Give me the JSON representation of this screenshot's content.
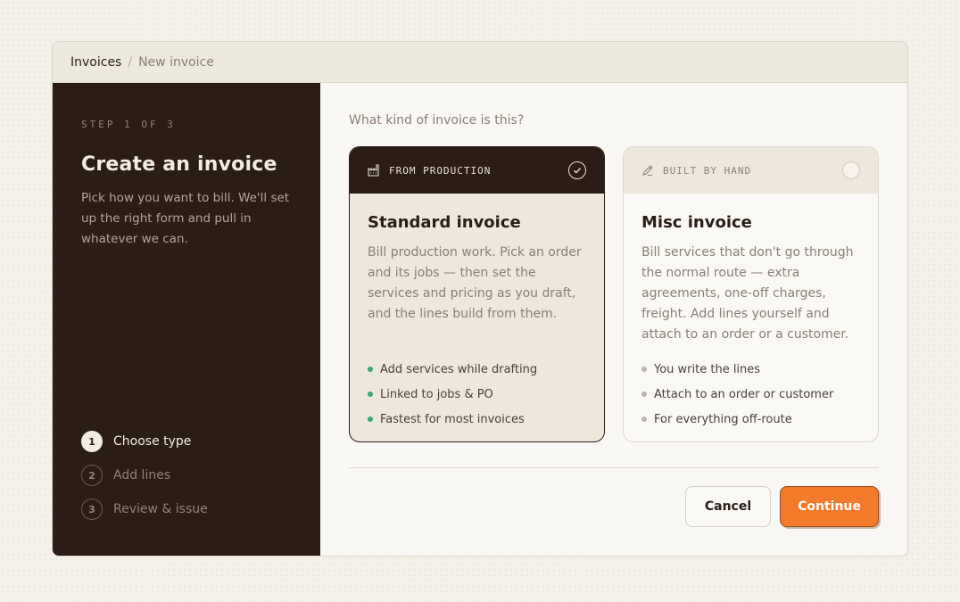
{
  "breadcrumb": {
    "parent": "Invoices",
    "separator": "/",
    "current": "New invoice"
  },
  "sidebar": {
    "step_label": "STEP 1 OF 3",
    "title": "Create an invoice",
    "description": "Pick how you want to bill. We'll set up the right form and pull in whatever we can.",
    "steps": [
      {
        "num": "1",
        "label": "Choose type",
        "state": "active"
      },
      {
        "num": "2",
        "label": "Add lines",
        "state": "inactive"
      },
      {
        "num": "3",
        "label": "Review & issue",
        "state": "inactive"
      }
    ]
  },
  "main": {
    "question": "What kind of invoice is this?",
    "cards": [
      {
        "tag": "FROM PRODUCTION",
        "icon": "factory-icon",
        "selected": true,
        "title": "Standard invoice",
        "description": "Bill production work. Pick an order and its jobs — then set the services and pricing as you draft, and the lines build from them.",
        "features": [
          "Add services while drafting",
          "Linked to jobs & PO",
          "Fastest for most invoices"
        ]
      },
      {
        "tag": "BUILT BY HAND",
        "icon": "pencil-icon",
        "selected": false,
        "title": "Misc invoice",
        "description": "Bill services that don't go through the normal route — extra agreements, one-off charges, freight. Add lines yourself and attach to an order or a customer.",
        "features": [
          "You write the lines",
          "Attach to an order or customer",
          "For everything off-route"
        ]
      }
    ],
    "actions": {
      "cancel": "Cancel",
      "continue": "Continue"
    }
  },
  "colors": {
    "sidebar_bg": "#2b1c16",
    "accent": "#f27a2a",
    "success_dot": "#3aa876"
  }
}
